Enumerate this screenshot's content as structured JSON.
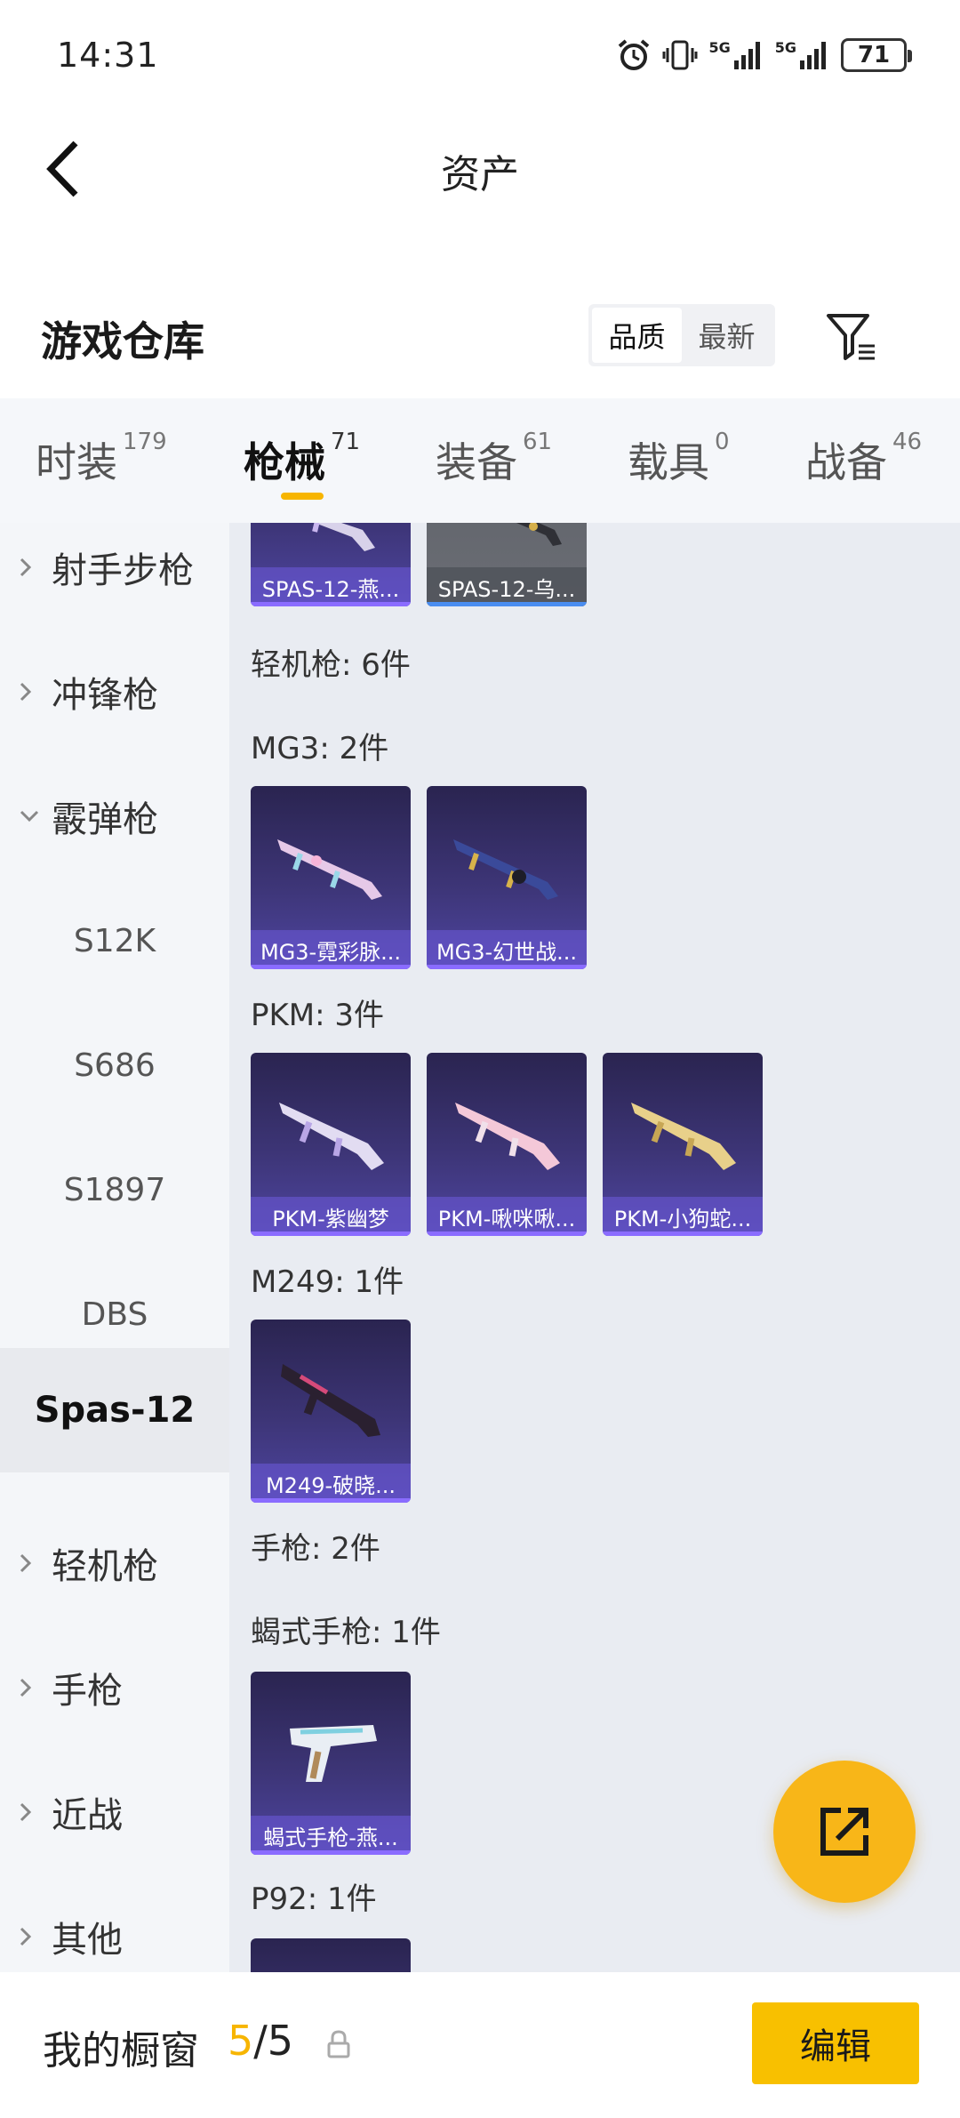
{
  "status_bar": {
    "time": "14:31",
    "network_1": "5G",
    "network_2": "5G",
    "battery": "71"
  },
  "header": {
    "title": "资产"
  },
  "section": {
    "title": "游戏仓库",
    "sort_options": [
      {
        "label": "品质",
        "active": true
      },
      {
        "label": "最新",
        "active": false
      }
    ]
  },
  "category_tabs": [
    {
      "label": "时装",
      "count": "179",
      "active": false
    },
    {
      "label": "枪械",
      "count": "71",
      "active": true
    },
    {
      "label": "装备",
      "count": "61",
      "active": false
    },
    {
      "label": "载具",
      "count": "0",
      "active": false
    },
    {
      "label": "战备",
      "count": "46",
      "active": false
    }
  ],
  "sidebar": [
    {
      "label": "射手步枪",
      "kind": "collapsed"
    },
    {
      "label": "冲锋枪",
      "kind": "collapsed"
    },
    {
      "label": "霰弹枪",
      "kind": "expanded"
    },
    {
      "label": "S12K",
      "kind": "sub"
    },
    {
      "label": "S686",
      "kind": "sub"
    },
    {
      "label": "S1897",
      "kind": "sub"
    },
    {
      "label": "DBS",
      "kind": "sub"
    },
    {
      "label": "Spas-12",
      "kind": "selected"
    },
    {
      "label": "轻机枪",
      "kind": "collapsed"
    },
    {
      "label": "手枪",
      "kind": "collapsed"
    },
    {
      "label": "近战",
      "kind": "collapsed"
    },
    {
      "label": "其他",
      "kind": "collapsed"
    }
  ],
  "content": {
    "top_cards": [
      {
        "name": "SPAS-12-燕...",
        "style": "purple"
      },
      {
        "name": "SPAS-12-乌...",
        "style": "grey"
      }
    ],
    "category_header": "轻机枪: 6件",
    "groups": [
      {
        "title": "MG3: 2件",
        "cards": [
          "MG3-霓彩脉...",
          "MG3-幻世战..."
        ]
      },
      {
        "title": "PKM: 3件",
        "cards": [
          "PKM-紫幽梦",
          "PKM-啾咪啾...",
          "PKM-小狗蛇..."
        ]
      },
      {
        "title": "M249: 1件",
        "cards": [
          "M249-破晓..."
        ]
      }
    ],
    "category_header_2": "手枪: 2件",
    "groups_2": [
      {
        "title": "蝎式手枪: 1件",
        "cards": [
          "蝎式手枪-燕..."
        ]
      },
      {
        "title": "P92: 1件",
        "cards": []
      }
    ]
  },
  "bottom_bar": {
    "label": "我的橱窗",
    "used": "5",
    "separator": "/",
    "total": "5",
    "edit_label": "编辑"
  },
  "colors": {
    "accent": "#f7b500",
    "card_purple": "#3d3577",
    "card_grey": "#6b6e75"
  },
  "icons": [
    "back-arrow-icon",
    "filter-icon",
    "alarm-icon",
    "vibrate-icon",
    "signal-icon",
    "battery-icon",
    "chevron-right-icon",
    "chevron-down-icon",
    "lock-icon",
    "share-icon"
  ]
}
